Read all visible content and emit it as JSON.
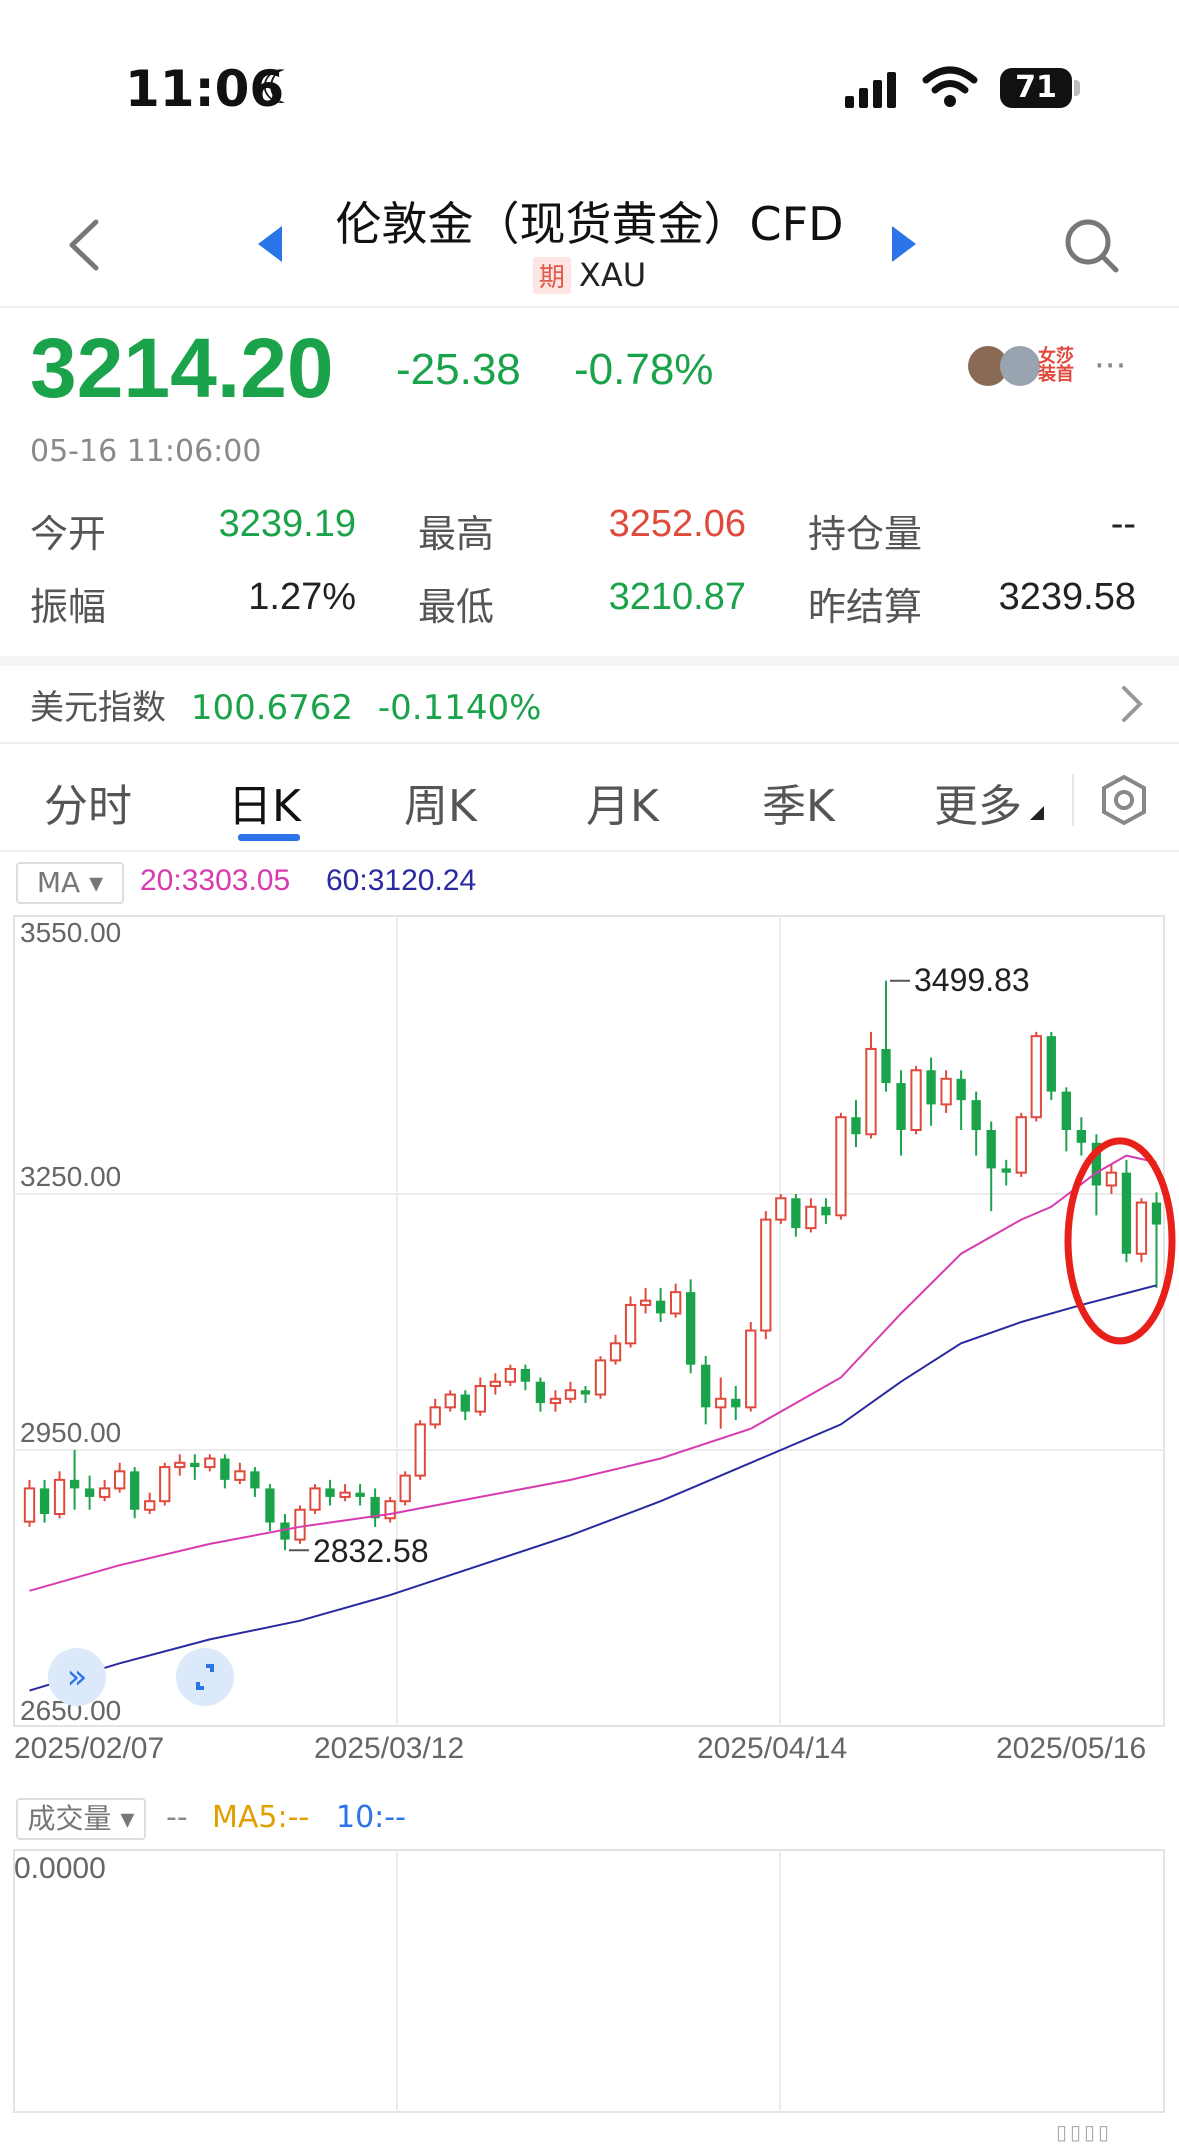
{
  "status_bar": {
    "time": "11:06",
    "battery": "71"
  },
  "header": {
    "title": "伦敦金（现货黄金）CFD",
    "market_tag": "期",
    "symbol": "XAU"
  },
  "quote": {
    "price": "3214.20",
    "change": "-25.38",
    "change_pct": "-0.78%",
    "timestamp": "05-16 11:06:00",
    "open_label": "今开",
    "open": "3239.19",
    "high_label": "最高",
    "high": "3252.06",
    "oi_label": "持仓量",
    "oi": "--",
    "amp_label": "振幅",
    "amp": "1.27%",
    "low_label": "最低",
    "low": "3210.87",
    "settle_label": "昨结算",
    "settle": "3239.58"
  },
  "dollar_index": {
    "label": "美元指数",
    "value": "100.6762",
    "change": "-0.1140%"
  },
  "tabs": [
    {
      "label": "分时"
    },
    {
      "label": "日K"
    },
    {
      "label": "周K"
    },
    {
      "label": "月K"
    },
    {
      "label": "季K"
    },
    {
      "label": "更多"
    }
  ],
  "indicator": {
    "name": "MA",
    "ma20": "20:3303.05",
    "ma60": "60:3120.24"
  },
  "volume_panel": {
    "label": "成交量",
    "dash": "--",
    "ma5": "MA5:--",
    "ma10": "10:--",
    "axis_value": "0.0000"
  },
  "colors": {
    "up": "#e04a3c",
    "down": "#1aa34a",
    "ma20": "#d83bb0",
    "ma60": "#2a2aa0",
    "annotation": "#e8201a"
  },
  "chart_data": {
    "type": "candlestick",
    "x_labels": [
      "2025/02/07",
      "2025/03/12",
      "2025/04/14",
      "2025/05/16"
    ],
    "y_ticks": [
      "3550.00",
      "3250.00",
      "2950.00",
      "2650.00"
    ],
    "ylim": [
      2650,
      3550
    ],
    "max_label": "3499.83",
    "min_label": "2832.58",
    "candles": [
      [
        2866,
        2905,
        2860,
        2915
      ],
      [
        2905,
        2875,
        2865,
        2915
      ],
      [
        2875,
        2915,
        2870,
        2925
      ],
      [
        2915,
        2905,
        2880,
        2950
      ],
      [
        2905,
        2895,
        2880,
        2920
      ],
      [
        2895,
        2905,
        2890,
        2915
      ],
      [
        2905,
        2925,
        2900,
        2935
      ],
      [
        2925,
        2880,
        2870,
        2930
      ],
      [
        2880,
        2890,
        2875,
        2900
      ],
      [
        2890,
        2930,
        2885,
        2935
      ],
      [
        2930,
        2935,
        2920,
        2945
      ],
      [
        2935,
        2930,
        2915,
        2945
      ],
      [
        2930,
        2940,
        2925,
        2945
      ],
      [
        2940,
        2915,
        2905,
        2945
      ],
      [
        2915,
        2925,
        2910,
        2935
      ],
      [
        2925,
        2905,
        2895,
        2930
      ],
      [
        2905,
        2865,
        2855,
        2910
      ],
      [
        2865,
        2845,
        2832.58,
        2875
      ],
      [
        2845,
        2880,
        2840,
        2885
      ],
      [
        2880,
        2905,
        2875,
        2910
      ],
      [
        2905,
        2895,
        2885,
        2915
      ],
      [
        2895,
        2900,
        2890,
        2910
      ],
      [
        2900,
        2895,
        2885,
        2910
      ],
      [
        2895,
        2870,
        2860,
        2905
      ],
      [
        2870,
        2890,
        2865,
        2895
      ],
      [
        2890,
        2920,
        2885,
        2925
      ],
      [
        2920,
        2980,
        2915,
        2985
      ],
      [
        2980,
        3000,
        2975,
        3010
      ],
      [
        3000,
        3015,
        2995,
        3020
      ],
      [
        3015,
        2995,
        2985,
        3020
      ],
      [
        2995,
        3025,
        2990,
        3035
      ],
      [
        3025,
        3030,
        3015,
        3040
      ],
      [
        3030,
        3045,
        3025,
        3050
      ],
      [
        3045,
        3030,
        3020,
        3050
      ],
      [
        3030,
        3005,
        2995,
        3035
      ],
      [
        3005,
        3010,
        2995,
        3020
      ],
      [
        3010,
        3020,
        3005,
        3030
      ],
      [
        3020,
        3015,
        3005,
        3025
      ],
      [
        3015,
        3055,
        3010,
        3060
      ],
      [
        3055,
        3075,
        3050,
        3085
      ],
      [
        3075,
        3120,
        3070,
        3130
      ],
      [
        3120,
        3125,
        3110,
        3140
      ],
      [
        3125,
        3110,
        3100,
        3140
      ],
      [
        3110,
        3135,
        3105,
        3145
      ],
      [
        3135,
        3050,
        3040,
        3150
      ],
      [
        3050,
        3000,
        2980,
        3060
      ],
      [
        3000,
        3010,
        2975,
        3035
      ],
      [
        3010,
        3000,
        2985,
        3025
      ],
      [
        3000,
        3090,
        2995,
        3100
      ],
      [
        3090,
        3220,
        3080,
        3230
      ],
      [
        3220,
        3245,
        3215,
        3250
      ],
      [
        3245,
        3210,
        3200,
        3250
      ],
      [
        3210,
        3235,
        3205,
        3245
      ],
      [
        3235,
        3225,
        3215,
        3245
      ],
      [
        3225,
        3340,
        3220,
        3345
      ],
      [
        3340,
        3320,
        3305,
        3360
      ],
      [
        3320,
        3420,
        3315,
        3440
      ],
      [
        3420,
        3380,
        3370,
        3499.83
      ],
      [
        3380,
        3325,
        3295,
        3395
      ],
      [
        3325,
        3395,
        3320,
        3400
      ],
      [
        3395,
        3355,
        3330,
        3410
      ],
      [
        3355,
        3385,
        3345,
        3395
      ],
      [
        3385,
        3360,
        3325,
        3395
      ],
      [
        3360,
        3325,
        3295,
        3370
      ],
      [
        3325,
        3280,
        3230,
        3335
      ],
      [
        3280,
        3275,
        3260,
        3290
      ],
      [
        3275,
        3340,
        3270,
        3345
      ],
      [
        3340,
        3435,
        3335,
        3440
      ],
      [
        3435,
        3370,
        3360,
        3440
      ],
      [
        3370,
        3325,
        3300,
        3375
      ],
      [
        3325,
        3310,
        3295,
        3340
      ],
      [
        3310,
        3260,
        3225,
        3320
      ],
      [
        3260,
        3275,
        3250,
        3285
      ],
      [
        3275,
        3180,
        3170,
        3290
      ],
      [
        3180,
        3240,
        3170,
        3245
      ],
      [
        3240,
        3214.2,
        3140,
        3252.06
      ]
    ],
    "ma20_path": [
      [
        0,
        2785
      ],
      [
        6,
        2815
      ],
      [
        12,
        2840
      ],
      [
        18,
        2860
      ],
      [
        24,
        2875
      ],
      [
        30,
        2895
      ],
      [
        36,
        2915
      ],
      [
        42,
        2940
      ],
      [
        48,
        2975
      ],
      [
        54,
        3035
      ],
      [
        58,
        3110
      ],
      [
        62,
        3180
      ],
      [
        66,
        3220
      ],
      [
        68,
        3235
      ],
      [
        71,
        3275
      ],
      [
        73,
        3295
      ],
      [
        75,
        3287
      ]
    ],
    "ma60_path": [
      [
        0,
        2668
      ],
      [
        6,
        2700
      ],
      [
        12,
        2728
      ],
      [
        18,
        2750
      ],
      [
        24,
        2780
      ],
      [
        30,
        2815
      ],
      [
        36,
        2850
      ],
      [
        42,
        2890
      ],
      [
        48,
        2935
      ],
      [
        54,
        2980
      ],
      [
        58,
        3030
      ],
      [
        62,
        3075
      ],
      [
        66,
        3100
      ],
      [
        70,
        3120
      ],
      [
        75,
        3143
      ]
    ]
  }
}
